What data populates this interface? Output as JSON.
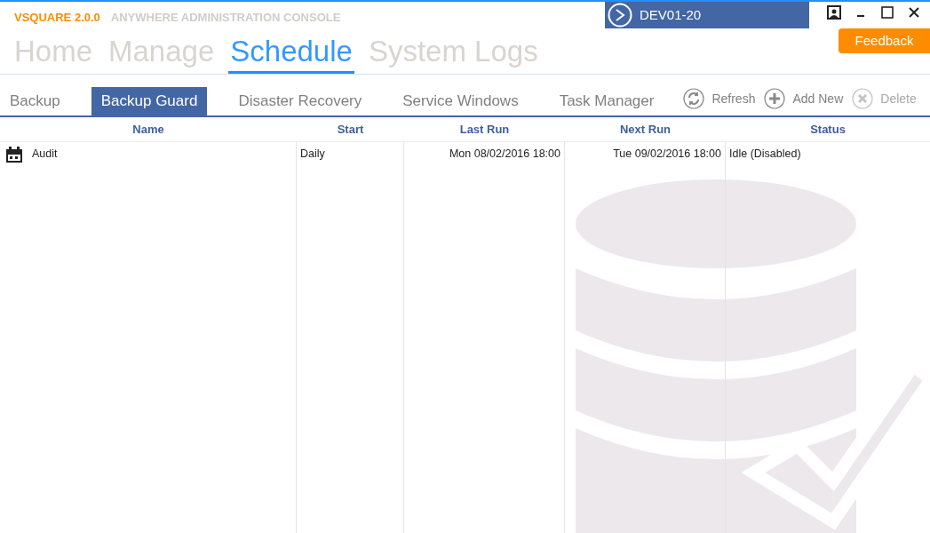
{
  "app": {
    "brand": "VSQUARE 2.0.0",
    "subtitle": "ANYWHERE ADMINISTRATION CONSOLE"
  },
  "server": {
    "name": "DEV01-20"
  },
  "feedback": "Feedback",
  "nav": [
    {
      "label": "Home",
      "selected": false
    },
    {
      "label": "Manage",
      "selected": false
    },
    {
      "label": "Schedule",
      "selected": true
    },
    {
      "label": "System Logs",
      "selected": false
    }
  ],
  "tabs": [
    {
      "label": "Backup",
      "selected": false
    },
    {
      "label": "Backup Guard",
      "selected": true
    },
    {
      "label": "Disaster Recovery",
      "selected": false
    },
    {
      "label": "Service Windows",
      "selected": false
    },
    {
      "label": "Task Manager",
      "selected": false
    }
  ],
  "actions": [
    {
      "kind": "refresh",
      "label": "Refresh",
      "disabled": false
    },
    {
      "kind": "add",
      "label": "Add New",
      "disabled": false
    },
    {
      "kind": "delete",
      "label": "Delete",
      "disabled": true
    }
  ],
  "table": {
    "columns": [
      "Name",
      "Start",
      "Last Run",
      "Next Run",
      "Status"
    ],
    "rows": [
      {
        "cells": [
          "Audit",
          "Daily",
          "Mon 08/02/2016 18:00",
          "Tue 09/02/2016 18:00",
          "Idle (Disabled)"
        ]
      }
    ]
  }
}
